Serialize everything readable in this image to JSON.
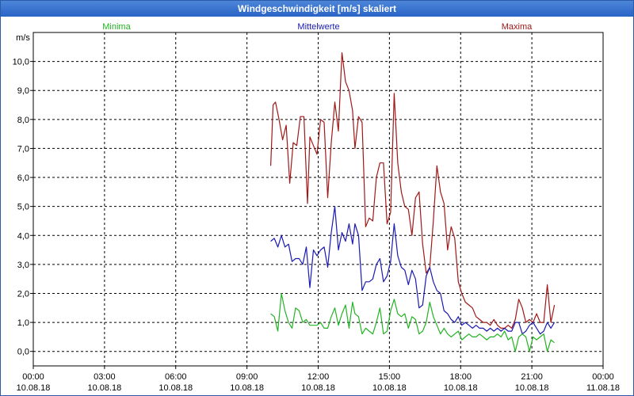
{
  "window": {
    "title": "Windgeschwindigkeit [m/s] skaliert"
  },
  "legend": {
    "min_label": "Minima",
    "mean_label": "Mittelwerte",
    "max_label": "Maxima"
  },
  "colors": {
    "min": "#22b422",
    "mean": "#1a1ab4",
    "max": "#a01818",
    "grid": "#000000"
  },
  "chart_data": {
    "type": "line",
    "ylabel": "m/s",
    "ylim": [
      -0.5,
      11.0
    ],
    "xlim": [
      0,
      24
    ],
    "grid": true,
    "yticks": [
      {
        "v": 0,
        "label": "0,0"
      },
      {
        "v": 1,
        "label": "1,0"
      },
      {
        "v": 2,
        "label": "2,0"
      },
      {
        "v": 3,
        "label": "3,0"
      },
      {
        "v": 4,
        "label": "4,0"
      },
      {
        "v": 5,
        "label": "5,0"
      },
      {
        "v": 6,
        "label": "6,0"
      },
      {
        "v": 7,
        "label": "7,0"
      },
      {
        "v": 8,
        "label": "8,0"
      },
      {
        "v": 9,
        "label": "9,0"
      },
      {
        "v": 10,
        "label": "10,0"
      }
    ],
    "xticks": [
      {
        "v": 0,
        "time": "00:00",
        "date": "10.08.18"
      },
      {
        "v": 3,
        "time": "03:00",
        "date": "10.08.18"
      },
      {
        "v": 6,
        "time": "06:00",
        "date": "10.08.18"
      },
      {
        "v": 9,
        "time": "09:00",
        "date": "10.08.18"
      },
      {
        "v": 12,
        "time": "12:00",
        "date": "10.08.18"
      },
      {
        "v": 15,
        "time": "15:00",
        "date": "10.08.18"
      },
      {
        "v": 18,
        "time": "18:00",
        "date": "10.08.18"
      },
      {
        "v": 21,
        "time": "21:00",
        "date": "10.08.18"
      },
      {
        "v": 24,
        "time": "00:00",
        "date": "11.08.18"
      }
    ],
    "series": [
      {
        "name": "Maxima",
        "key": "max",
        "points": [
          [
            10.0,
            6.4
          ],
          [
            10.1,
            8.5
          ],
          [
            10.2,
            8.6
          ],
          [
            10.35,
            8.0
          ],
          [
            10.5,
            7.3
          ],
          [
            10.65,
            7.8
          ],
          [
            10.8,
            5.8
          ],
          [
            10.95,
            7.2
          ],
          [
            11.1,
            7.1
          ],
          [
            11.25,
            8.1
          ],
          [
            11.4,
            8.1
          ],
          [
            11.55,
            5.1
          ],
          [
            11.65,
            7.4
          ],
          [
            11.8,
            7.1
          ],
          [
            11.95,
            6.8
          ],
          [
            12.1,
            8.0
          ],
          [
            12.25,
            7.9
          ],
          [
            12.4,
            5.3
          ],
          [
            12.55,
            7.2
          ],
          [
            12.7,
            8.6
          ],
          [
            12.85,
            7.6
          ],
          [
            13.0,
            10.3
          ],
          [
            13.15,
            9.3
          ],
          [
            13.3,
            9.0
          ],
          [
            13.45,
            8.3
          ],
          [
            13.55,
            7.0
          ],
          [
            13.7,
            8.1
          ],
          [
            13.85,
            7.9
          ],
          [
            14.0,
            4.3
          ],
          [
            14.15,
            4.6
          ],
          [
            14.3,
            4.5
          ],
          [
            14.45,
            6.0
          ],
          [
            14.6,
            6.5
          ],
          [
            14.75,
            6.5
          ],
          [
            14.9,
            4.4
          ],
          [
            15.05,
            4.8
          ],
          [
            15.2,
            8.9
          ],
          [
            15.35,
            6.5
          ],
          [
            15.5,
            5.5
          ],
          [
            15.65,
            5.0
          ],
          [
            15.8,
            4.9
          ],
          [
            15.95,
            4.0
          ],
          [
            16.1,
            5.3
          ],
          [
            16.25,
            5.5
          ],
          [
            16.4,
            3.7
          ],
          [
            16.55,
            2.7
          ],
          [
            16.7,
            2.9
          ],
          [
            16.85,
            4.5
          ],
          [
            17.0,
            6.4
          ],
          [
            17.15,
            5.5
          ],
          [
            17.3,
            5.1
          ],
          [
            17.45,
            3.5
          ],
          [
            17.6,
            4.3
          ],
          [
            17.75,
            3.9
          ],
          [
            17.9,
            2.4
          ],
          [
            18.05,
            2.0
          ],
          [
            18.2,
            1.7
          ],
          [
            18.35,
            1.6
          ],
          [
            18.5,
            1.5
          ],
          [
            18.65,
            1.2
          ],
          [
            18.8,
            1.1
          ],
          [
            18.95,
            1.0
          ],
          [
            19.1,
            1.0
          ],
          [
            19.25,
            0.9
          ],
          [
            19.4,
            1.1
          ],
          [
            19.55,
            0.9
          ],
          [
            19.7,
            0.8
          ],
          [
            19.85,
            0.8
          ],
          [
            20.0,
            0.9
          ],
          [
            20.15,
            0.8
          ],
          [
            20.3,
            1.1
          ],
          [
            20.45,
            1.8
          ],
          [
            20.6,
            1.5
          ],
          [
            20.75,
            1.0
          ],
          [
            20.9,
            1.1
          ],
          [
            21.05,
            1.0
          ],
          [
            21.2,
            1.3
          ],
          [
            21.35,
            1.0
          ],
          [
            21.5,
            1.0
          ],
          [
            21.65,
            2.3
          ],
          [
            21.8,
            1.0
          ],
          [
            21.95,
            1.6
          ]
        ]
      },
      {
        "name": "Mittelwerte",
        "key": "mean",
        "points": [
          [
            10.0,
            3.8
          ],
          [
            10.15,
            3.9
          ],
          [
            10.3,
            3.6
          ],
          [
            10.45,
            4.0
          ],
          [
            10.6,
            3.6
          ],
          [
            10.75,
            3.7
          ],
          [
            10.9,
            3.1
          ],
          [
            11.05,
            3.2
          ],
          [
            11.2,
            3.2
          ],
          [
            11.35,
            3.0
          ],
          [
            11.5,
            3.6
          ],
          [
            11.65,
            2.2
          ],
          [
            11.8,
            3.5
          ],
          [
            11.95,
            3.3
          ],
          [
            12.1,
            3.5
          ],
          [
            12.25,
            3.6
          ],
          [
            12.4,
            2.9
          ],
          [
            12.55,
            4.1
          ],
          [
            12.7,
            5.0
          ],
          [
            12.85,
            3.5
          ],
          [
            13.0,
            4.1
          ],
          [
            13.15,
            3.8
          ],
          [
            13.3,
            4.4
          ],
          [
            13.45,
            3.7
          ],
          [
            13.55,
            4.4
          ],
          [
            13.7,
            4.0
          ],
          [
            13.85,
            2.1
          ],
          [
            14.0,
            2.4
          ],
          [
            14.15,
            2.4
          ],
          [
            14.3,
            2.5
          ],
          [
            14.45,
            3.0
          ],
          [
            14.6,
            3.2
          ],
          [
            14.75,
            2.4
          ],
          [
            14.9,
            2.6
          ],
          [
            15.05,
            3.1
          ],
          [
            15.2,
            4.4
          ],
          [
            15.35,
            3.3
          ],
          [
            15.5,
            2.9
          ],
          [
            15.65,
            2.8
          ],
          [
            15.8,
            2.3
          ],
          [
            15.95,
            2.8
          ],
          [
            16.1,
            2.5
          ],
          [
            16.25,
            1.5
          ],
          [
            16.4,
            1.6
          ],
          [
            16.55,
            2.6
          ],
          [
            16.7,
            2.9
          ],
          [
            16.85,
            2.4
          ],
          [
            17.0,
            2.1
          ],
          [
            17.15,
            2.0
          ],
          [
            17.3,
            1.4
          ],
          [
            17.45,
            1.3
          ],
          [
            17.6,
            1.1
          ],
          [
            17.75,
            1.0
          ],
          [
            17.9,
            1.2
          ],
          [
            18.05,
            0.9
          ],
          [
            18.2,
            1.0
          ],
          [
            18.35,
            0.9
          ],
          [
            18.5,
            0.8
          ],
          [
            18.65,
            0.9
          ],
          [
            18.8,
            0.8
          ],
          [
            18.95,
            0.8
          ],
          [
            19.1,
            0.7
          ],
          [
            19.25,
            0.8
          ],
          [
            19.4,
            0.7
          ],
          [
            19.55,
            0.8
          ],
          [
            19.7,
            0.7
          ],
          [
            19.85,
            0.8
          ],
          [
            20.0,
            0.7
          ],
          [
            20.15,
            0.7
          ],
          [
            20.3,
            1.0
          ],
          [
            20.45,
            1.0
          ],
          [
            20.6,
            0.6
          ],
          [
            20.75,
            0.7
          ],
          [
            20.9,
            0.9
          ],
          [
            21.05,
            1.0
          ],
          [
            21.2,
            0.8
          ],
          [
            21.35,
            0.6
          ],
          [
            21.5,
            0.7
          ],
          [
            21.65,
            1.0
          ],
          [
            21.8,
            0.8
          ],
          [
            21.95,
            1.0
          ]
        ]
      },
      {
        "name": "Minima",
        "key": "min",
        "points": [
          [
            10.0,
            1.3
          ],
          [
            10.15,
            1.2
          ],
          [
            10.3,
            0.7
          ],
          [
            10.45,
            2.0
          ],
          [
            10.6,
            1.4
          ],
          [
            10.75,
            1.0
          ],
          [
            10.9,
            0.8
          ],
          [
            11.05,
            1.5
          ],
          [
            11.2,
            1.4
          ],
          [
            11.35,
            1.0
          ],
          [
            11.5,
            1.1
          ],
          [
            11.65,
            0.9
          ],
          [
            11.8,
            0.9
          ],
          [
            11.95,
            0.9
          ],
          [
            12.1,
            1.0
          ],
          [
            12.25,
            0.8
          ],
          [
            12.4,
            0.8
          ],
          [
            12.55,
            1.2
          ],
          [
            12.7,
            1.5
          ],
          [
            12.85,
            0.9
          ],
          [
            13.0,
            1.3
          ],
          [
            13.15,
            1.6
          ],
          [
            13.3,
            0.8
          ],
          [
            13.45,
            1.7
          ],
          [
            13.55,
            1.3
          ],
          [
            13.7,
            1.2
          ],
          [
            13.85,
            0.6
          ],
          [
            14.0,
            0.8
          ],
          [
            14.15,
            0.7
          ],
          [
            14.3,
            0.6
          ],
          [
            14.45,
            1.0
          ],
          [
            14.6,
            1.5
          ],
          [
            14.75,
            0.6
          ],
          [
            14.9,
            0.7
          ],
          [
            15.05,
            1.4
          ],
          [
            15.2,
            1.8
          ],
          [
            15.35,
            1.3
          ],
          [
            15.5,
            1.2
          ],
          [
            15.65,
            1.3
          ],
          [
            15.8,
            0.8
          ],
          [
            15.95,
            1.2
          ],
          [
            16.1,
            1.1
          ],
          [
            16.25,
            0.6
          ],
          [
            16.4,
            0.7
          ],
          [
            16.55,
            1.0
          ],
          [
            16.7,
            1.7
          ],
          [
            16.85,
            1.2
          ],
          [
            17.0,
            0.9
          ],
          [
            17.15,
            0.6
          ],
          [
            17.3,
            0.8
          ],
          [
            17.45,
            0.6
          ],
          [
            17.6,
            0.5
          ],
          [
            17.75,
            0.6
          ],
          [
            17.9,
            0.7
          ],
          [
            18.05,
            0.4
          ],
          [
            18.2,
            0.5
          ],
          [
            18.35,
            0.6
          ],
          [
            18.5,
            0.5
          ],
          [
            18.65,
            0.5
          ],
          [
            18.8,
            0.6
          ],
          [
            18.95,
            0.5
          ],
          [
            19.1,
            0.4
          ],
          [
            19.25,
            0.5
          ],
          [
            19.4,
            0.5
          ],
          [
            19.55,
            0.6
          ],
          [
            19.7,
            0.5
          ],
          [
            19.85,
            0.7
          ],
          [
            20.0,
            0.4
          ],
          [
            20.15,
            0.5
          ],
          [
            20.3,
            0.0
          ],
          [
            20.45,
            0.5
          ],
          [
            20.6,
            0.6
          ],
          [
            20.75,
            0.5
          ],
          [
            20.9,
            0.0
          ],
          [
            21.05,
            0.5
          ],
          [
            21.2,
            0.4
          ],
          [
            21.35,
            0.5
          ],
          [
            21.5,
            0.6
          ],
          [
            21.65,
            0.0
          ],
          [
            21.8,
            0.4
          ],
          [
            21.95,
            0.3
          ]
        ]
      }
    ]
  }
}
